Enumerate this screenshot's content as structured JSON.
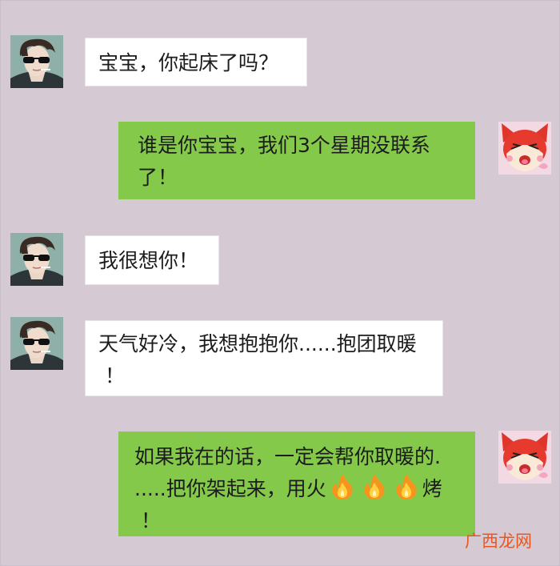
{
  "messages": [
    {
      "side": "left",
      "text": "宝宝，你起床了吗？"
    },
    {
      "side": "right",
      "line1": "谁是你宝宝，我们3个星期没联系",
      "line2": "了！"
    },
    {
      "side": "left",
      "text": "我很想你！"
    },
    {
      "side": "left",
      "line1": "天气好冷，我想抱抱你......抱团取暖",
      "line2": "！"
    },
    {
      "side": "right",
      "line1": "如果我在的话，一定会帮你取暖的.",
      "line2_before": ".....把你架起来，用火",
      "line2_after": "烤",
      "line3": "！"
    }
  ],
  "icons": {
    "left_avatar": "boy-with-sunglasses-avatar",
    "right_avatar": "red-fox-cartoon-avatar",
    "emoji": "fire-icon"
  },
  "watermark": "广西龙网",
  "colors": {
    "background": "#d5cad4",
    "sent_bubble": "#85c94a",
    "received_bubble": "#ffffff",
    "watermark": "#e8571f"
  }
}
